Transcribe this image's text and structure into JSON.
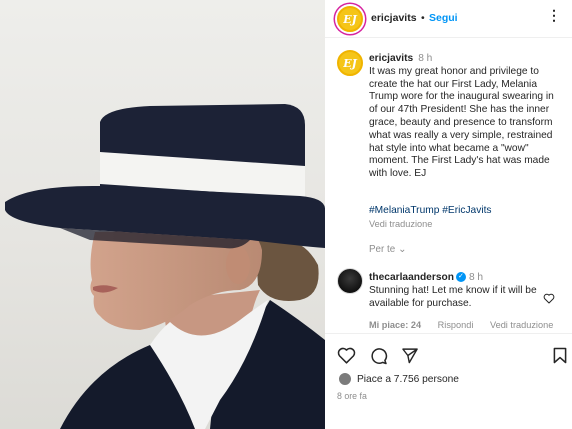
{
  "header": {
    "avatar_initials": "EJ",
    "username": "ericjavits",
    "separator": "•",
    "follow_label": "Segui",
    "more_label": "⋮"
  },
  "caption": {
    "avatar_initials": "EJ",
    "username": "ericjavits",
    "time": "8 h",
    "text": "It was my great honor and privilege to create the hat our First Lady, Melania Trump wore for the inaugural swearing in of our 47th President! She has the inner grace, beauty and presence to transform what was really a very simple, restrained hat style into what became a \"wow\" moment. The First Lady's hat was made with love. EJ",
    "hashtags": [
      "#MelaniaTrump",
      "#EricJavits"
    ],
    "translate_label": "Vedi traduzione"
  },
  "per_te": {
    "label": "Per te",
    "chevron": "⌄"
  },
  "comment": {
    "username": "thecarlaanderson",
    "verified_mark": "✓",
    "time": "8 h",
    "text": "Stunning hat! Let me know if it will be available for purchase.",
    "likes_label": "Mi piace: 24",
    "reply_label": "Rispondi",
    "translate_label": "Vedi traduzione"
  },
  "actions": {
    "icons": [
      "heart-icon",
      "comment-icon",
      "share-icon",
      "bookmark-icon"
    ],
    "likes_text": "Piace a 7.756 persone",
    "time_ago": "8 ore fa"
  },
  "colors": {
    "link_blue": "#0095f6",
    "hashtag_blue": "#00376b",
    "muted": "#8e8e8e",
    "avatar_gold": "#f5c518",
    "hat_navy": "#1c2236"
  }
}
